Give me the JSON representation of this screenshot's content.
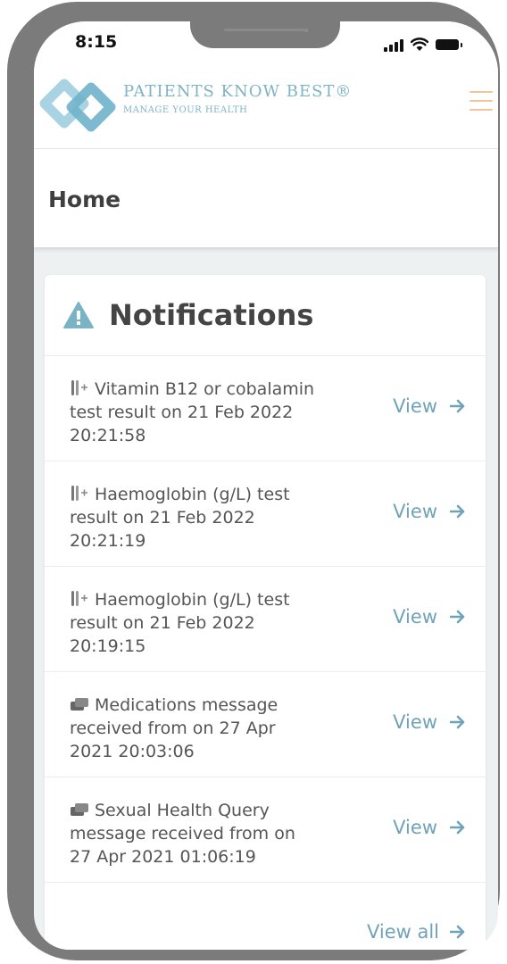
{
  "status_bar": {
    "time": "8:15"
  },
  "header": {
    "brand_name": "PATIENTS KNOW BEST®",
    "brand_tagline": "MANAGE YOUR HEALTH",
    "menu_icon": "hamburger-icon",
    "colors": {
      "brand": "#7fb3c6",
      "menu": "#f3c39a"
    }
  },
  "page": {
    "title": "Home"
  },
  "notifications": {
    "title": "Notifications",
    "title_icon": "warning-icon",
    "view_label": "View",
    "view_all_label": "View all",
    "items": [
      {
        "icon": "test-tube-icon",
        "text": "Vitamin B12 or cobalamin test result on 21 Feb 2022 20:21:58"
      },
      {
        "icon": "test-tube-icon",
        "text": "Haemoglobin (g/L) test result on 21 Feb 2022 20:21:19"
      },
      {
        "icon": "test-tube-icon",
        "text": "Haemoglobin (g/L) test result on 21 Feb 2022 20:19:15"
      },
      {
        "icon": "message-icon",
        "text": "Medications message received from on 27 Apr 2021 20:03:06"
      },
      {
        "icon": "message-icon",
        "text": "Sexual Health Query message received from on 27 Apr 2021 01:06:19"
      }
    ],
    "colors": {
      "link": "#6fa3b8",
      "title_icon": "#7ab3c4"
    }
  }
}
